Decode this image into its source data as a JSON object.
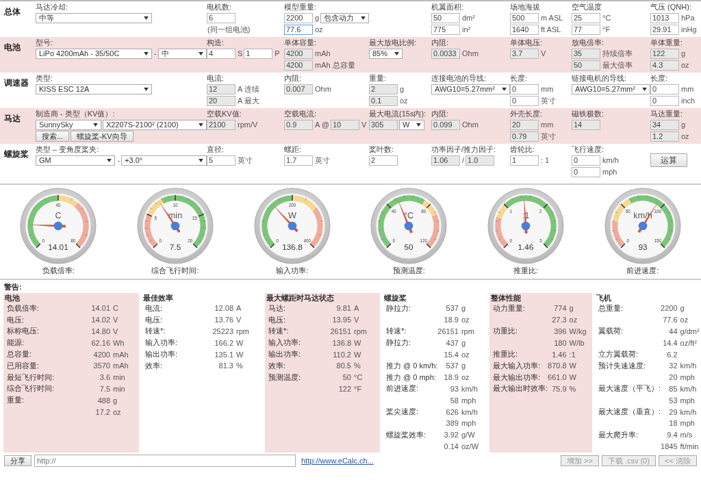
{
  "sections": [
    {
      "title": "总体",
      "cells": [
        {
          "label": "马达冷却:",
          "lines": [
            [
              {
                "kind": "select",
                "value": "中等"
              }
            ]
          ]
        },
        {
          "label": "电机数:",
          "lines": [
            [
              {
                "kind": "input",
                "value": "6",
                "readonly": false
              }
            ],
            [
              {
                "kind": "note",
                "text": "(同一组电池)"
              }
            ]
          ]
        },
        {
          "label": "模型重量:",
          "lines": [
            [
              {
                "kind": "input",
                "value": "2200",
                "readonly": false
              },
              {
                "kind": "unit",
                "text": "g"
              },
              {
                "kind": "select",
                "value": "包含动力"
              }
            ],
            [
              {
                "kind": "input",
                "value": "77.6",
                "readonly": false,
                "focused": true
              },
              {
                "kind": "unit",
                "text": "oz"
              }
            ]
          ]
        },
        {
          "label": "机翼面积:",
          "lines": [
            [
              {
                "kind": "input",
                "value": "50",
                "readonly": false
              },
              {
                "kind": "unit",
                "text": "dm²"
              }
            ],
            [
              {
                "kind": "input",
                "value": "775",
                "readonly": false
              },
              {
                "kind": "unit",
                "text": "in²"
              }
            ]
          ]
        },
        {
          "label": "场地海拔",
          "lines": [
            [
              {
                "kind": "input",
                "value": "500",
                "readonly": false
              },
              {
                "kind": "unit",
                "text": "m ASL"
              }
            ],
            [
              {
                "kind": "input",
                "value": "1640",
                "readonly": false
              },
              {
                "kind": "unit",
                "text": "ft ASL"
              }
            ]
          ]
        },
        {
          "label": "空气温度",
          "lines": [
            [
              {
                "kind": "input",
                "value": "25",
                "readonly": false
              },
              {
                "kind": "unit",
                "text": "°C"
              }
            ],
            [
              {
                "kind": "input",
                "value": "77",
                "readonly": false
              },
              {
                "kind": "unit",
                "text": "°F"
              }
            ]
          ]
        },
        {
          "label": "气压 (QNH):",
          "lines": [
            [
              {
                "kind": "input",
                "value": "1013",
                "readonly": false
              },
              {
                "kind": "unit",
                "text": "hPa"
              }
            ],
            [
              {
                "kind": "input",
                "value": "29.91",
                "readonly": false
              },
              {
                "kind": "unit",
                "text": "inHg"
              }
            ]
          ]
        }
      ]
    },
    {
      "title": "电池",
      "cells": [
        {
          "label": "型号:",
          "lines": [
            [
              {
                "kind": "select",
                "value": "LiPo 4200mAh - 35/50C"
              },
              {
                "kind": "unit",
                "text": "-"
              },
              {
                "kind": "select",
                "value": "中"
              }
            ]
          ]
        },
        {
          "label": "构造:",
          "lines": [
            [
              {
                "kind": "input",
                "value": "4",
                "readonly": false
              },
              {
                "kind": "unit",
                "text": "S"
              },
              {
                "kind": "input",
                "value": "1",
                "readonly": false
              },
              {
                "kind": "unit",
                "text": "P"
              }
            ]
          ]
        },
        {
          "label": "单体容量:",
          "lines": [
            [
              {
                "kind": "input",
                "value": "4200",
                "readonly": true
              },
              {
                "kind": "unit",
                "text": "mAh"
              }
            ],
            [
              {
                "kind": "input",
                "value": "4200",
                "readonly": true
              },
              {
                "kind": "unit",
                "text": "mAh 总容量"
              }
            ]
          ]
        },
        {
          "label": "最大放电比例:",
          "lines": [
            [
              {
                "kind": "select",
                "value": "85%"
              }
            ]
          ]
        },
        {
          "label": "内阻:",
          "lines": [
            [
              {
                "kind": "input",
                "value": "0.0033",
                "readonly": true
              },
              {
                "kind": "unit",
                "text": "Ohm"
              }
            ]
          ]
        },
        {
          "label": "单体电压:",
          "lines": [
            [
              {
                "kind": "input",
                "value": "3.7",
                "readonly": true
              },
              {
                "kind": "unit",
                "text": "V"
              }
            ]
          ]
        },
        {
          "label": "放电倍率:",
          "lines": [
            [
              {
                "kind": "input",
                "value": "35",
                "readonly": true
              },
              {
                "kind": "unit",
                "text": "持续倍率"
              }
            ],
            [
              {
                "kind": "input",
                "value": "50",
                "readonly": true
              },
              {
                "kind": "unit",
                "text": "最大倍率"
              }
            ]
          ]
        },
        {
          "label": "单体重量:",
          "lines": [
            [
              {
                "kind": "input",
                "value": "122",
                "readonly": true
              },
              {
                "kind": "unit",
                "text": "g"
              }
            ],
            [
              {
                "kind": "input",
                "value": "4.3",
                "readonly": true
              },
              {
                "kind": "unit",
                "text": "oz"
              }
            ]
          ]
        }
      ]
    },
    {
      "title": "调速器",
      "cells": [
        {
          "label": "类型:",
          "lines": [
            [
              {
                "kind": "select",
                "value": "KISS ESC 12A"
              }
            ]
          ]
        },
        {
          "label": "电流:",
          "lines": [
            [
              {
                "kind": "input",
                "value": "12",
                "readonly": true
              },
              {
                "kind": "unit",
                "text": "A 连续"
              }
            ],
            [
              {
                "kind": "input",
                "value": "20",
                "readonly": true
              },
              {
                "kind": "unit",
                "text": "A 最大"
              }
            ]
          ]
        },
        {
          "label": "内阻:",
          "lines": [
            [
              {
                "kind": "input",
                "value": "0.007",
                "readonly": true
              },
              {
                "kind": "unit",
                "text": "Ohm"
              }
            ]
          ]
        },
        {
          "label": "重量:",
          "lines": [
            [
              {
                "kind": "input",
                "value": "2",
                "readonly": true
              },
              {
                "kind": "unit",
                "text": "g"
              }
            ],
            [
              {
                "kind": "input",
                "value": "0.1",
                "readonly": true
              },
              {
                "kind": "unit",
                "text": "oz"
              }
            ]
          ]
        },
        {
          "label": "连接电池的导线:",
          "lines": [
            [
              {
                "kind": "select",
                "value": "AWG10=5.27mm²"
              }
            ]
          ]
        },
        {
          "label": "长度:",
          "lines": [
            [
              {
                "kind": "input",
                "value": "0",
                "readonly": false
              },
              {
                "kind": "unit",
                "text": "mm"
              }
            ],
            [
              {
                "kind": "input",
                "value": "0",
                "readonly": false
              },
              {
                "kind": "unit",
                "text": "英寸"
              }
            ]
          ]
        },
        {
          "label": "链接电机的导线:",
          "lines": [
            [
              {
                "kind": "select",
                "value": "AWG10=5.27mm²"
              }
            ]
          ]
        },
        {
          "label": "长度:",
          "lines": [
            [
              {
                "kind": "input",
                "value": "0",
                "readonly": false
              },
              {
                "kind": "unit",
                "text": "mm"
              }
            ],
            [
              {
                "kind": "input",
                "value": "0",
                "readonly": false
              },
              {
                "kind": "unit",
                "text": "inch"
              }
            ]
          ]
        }
      ]
    },
    {
      "title": "马达",
      "cells": [
        {
          "label": "制造商 - 类型（KV值）:",
          "lines": [
            [
              {
                "kind": "select",
                "value": "SunnySky"
              },
              {
                "kind": "select",
                "value": "X2207S-2100² (2100)"
              }
            ],
            [
              {
                "kind": "button",
                "text": "搜索..."
              },
              {
                "kind": "button",
                "text": "螺旋桨-KV向导"
              }
            ]
          ]
        },
        {
          "label": "空载KV值:",
          "lines": [
            [
              {
                "kind": "input",
                "value": "2100",
                "readonly": true
              },
              {
                "kind": "unit",
                "text": "rpm/V"
              }
            ]
          ]
        },
        {
          "label": "空载电流:",
          "lines": [
            [
              {
                "kind": "input",
                "value": "0.9",
                "readonly": true
              },
              {
                "kind": "unit",
                "text": "A @"
              },
              {
                "kind": "input",
                "value": "10",
                "readonly": true
              },
              {
                "kind": "unit",
                "text": "V"
              }
            ]
          ]
        },
        {
          "label": "最大电流(15s内):",
          "lines": [
            [
              {
                "kind": "input",
                "value": "305",
                "readonly": true
              },
              {
                "kind": "select",
                "value": "W"
              }
            ]
          ]
        },
        {
          "label": "内阻:",
          "lines": [
            [
              {
                "kind": "input",
                "value": "0.099",
                "readonly": true
              },
              {
                "kind": "unit",
                "text": "Ohm"
              }
            ]
          ]
        },
        {
          "label": "外壳长度:",
          "lines": [
            [
              {
                "kind": "input",
                "value": "20",
                "readonly": true
              },
              {
                "kind": "unit",
                "text": "mm"
              }
            ],
            [
              {
                "kind": "input",
                "value": "0.79",
                "readonly": true
              },
              {
                "kind": "unit",
                "text": "英寸"
              }
            ]
          ]
        },
        {
          "label": "磁铁极数:",
          "lines": [
            [
              {
                "kind": "input",
                "value": "14",
                "readonly": true
              }
            ]
          ]
        },
        {
          "label": "马达重量:",
          "lines": [
            [
              {
                "kind": "input",
                "value": "34",
                "readonly": true
              },
              {
                "kind": "unit",
                "text": "g"
              }
            ],
            [
              {
                "kind": "input",
                "value": "1.2",
                "readonly": true
              },
              {
                "kind": "unit",
                "text": "oz"
              }
            ]
          ]
        }
      ]
    },
    {
      "title": "螺旋桨",
      "cells": [
        {
          "label": "类型 – 变角度桨夹:",
          "lines": [
            [
              {
                "kind": "select",
                "value": "GM"
              },
              {
                "kind": "unit",
                "text": "-"
              },
              {
                "kind": "select",
                "value": "+3.0°"
              }
            ]
          ]
        },
        {
          "label": "直径:",
          "lines": [
            [
              {
                "kind": "input",
                "value": "5",
                "readonly": false
              },
              {
                "kind": "unit",
                "text": "英寸"
              }
            ]
          ]
        },
        {
          "label": "螺距:",
          "lines": [
            [
              {
                "kind": "input",
                "value": "1.7",
                "readonly": false
              },
              {
                "kind": "unit",
                "text": "英寸"
              }
            ]
          ]
        },
        {
          "label": "桨叶数:",
          "lines": [
            [
              {
                "kind": "input",
                "value": "2",
                "readonly": false
              }
            ]
          ]
        },
        {
          "label": "功率因子/推力因子:",
          "lines": [
            [
              {
                "kind": "input",
                "value": "1.06",
                "readonly": true
              },
              {
                "kind": "unit",
                "text": "/"
              },
              {
                "kind": "input",
                "value": "1.0",
                "readonly": true
              }
            ]
          ]
        },
        {
          "label": "齿轮比:",
          "lines": [
            [
              {
                "kind": "input",
                "value": "1",
                "readonly": false
              },
              {
                "kind": "unit",
                "text": ": 1"
              }
            ]
          ]
        },
        {
          "label": "飞行速度:",
          "lines": [
            [
              {
                "kind": "input",
                "value": "0",
                "readonly": false
              },
              {
                "kind": "unit",
                "text": "km/h"
              }
            ],
            [
              {
                "kind": "input",
                "value": "0",
                "readonly": false
              },
              {
                "kind": "unit",
                "text": "mph"
              }
            ]
          ]
        },
        {
          "lines": [
            [
              {
                "kind": "button",
                "text": "运算"
              }
            ]
          ]
        }
      ]
    }
  ],
  "gauges": [
    {
      "unit": "C",
      "value": "14.01",
      "label": "负载倍率:",
      "level": 0.175,
      "ticks": [
        "0",
        "40",
        "80"
      ]
    },
    {
      "unit": "min",
      "value": "7.5",
      "label": "综合飞行时间:",
      "level": 0.375,
      "ticks": [
        "0",
        "5",
        "10",
        "15",
        "20"
      ]
    },
    {
      "unit": "W",
      "value": "136.8",
      "label": "输入功率:",
      "level": 0.342,
      "ticks": [
        "0",
        "200",
        "400"
      ]
    },
    {
      "unit": "°C",
      "value": "50",
      "label": "预测温度:",
      "level": 0.417,
      "ticks": [
        "40",
        "80",
        "0",
        "120"
      ]
    },
    {
      "unit": ":1",
      "value": "1.46",
      "label": "推重比:",
      "level": 0.487,
      "ticks": [
        "1",
        "2",
        "0",
        "3"
      ]
    },
    {
      "unit": "km/h",
      "value": "93",
      "label": "前进速度:",
      "level": 0.62,
      "ticks": [
        "50",
        "100",
        "0",
        "150"
      ]
    }
  ],
  "warning_label": "警告:",
  "panels": [
    {
      "title": "电池",
      "rows": [
        {
          "label": "负载倍率:",
          "value": "14.01",
          "unit": "C"
        },
        {
          "label": "电压:",
          "value": "14.02",
          "unit": "V"
        },
        {
          "label": "标称电压:",
          "value": "14.80",
          "unit": "V"
        },
        {
          "label": "能源:",
          "value": "62.16",
          "unit": "Wh"
        },
        {
          "label": "总容量:",
          "value": "4200",
          "unit": "mAh"
        },
        {
          "label": "已用容量:",
          "value": "3570",
          "unit": "mAh"
        },
        {
          "label": "最短飞行时间:",
          "value": "3.6",
          "unit": "min"
        },
        {
          "label": "综合飞行时间:",
          "value": "7.5",
          "unit": "min"
        },
        {
          "label": "重量:",
          "value": "488",
          "unit": "g"
        },
        {
          "value": "17.2",
          "unit": "oz"
        }
      ]
    },
    {
      "title": "最佳效率",
      "rows": [
        {
          "label": "电流:",
          "value": "12.08",
          "unit": "A"
        },
        {
          "label": "电压:",
          "value": "13.76",
          "unit": "V"
        },
        {
          "label": "转速*:",
          "value": "25223",
          "unit": "rpm"
        },
        {
          "label": "输入功率:",
          "value": "166.2",
          "unit": "W"
        },
        {
          "label": "输出功率:",
          "value": "135.1",
          "unit": "W"
        },
        {
          "label": "效率:",
          "value": "81.3",
          "unit": "%"
        }
      ]
    },
    {
      "title": "最大螺距时马达状态",
      "rows": [
        {
          "label": "马达:",
          "value": "9.81",
          "unit": "A"
        },
        {
          "label": "电压:",
          "value": "13.95",
          "unit": "V"
        },
        {
          "label": "转速*:",
          "value": "26151",
          "unit": "rpm"
        },
        {
          "label": "输入功率:",
          "value": "136.8",
          "unit": "W"
        },
        {
          "label": "输出功率:",
          "value": "110.2",
          "unit": "W"
        },
        {
          "label": "效率:",
          "value": "80.5",
          "unit": "%"
        },
        {
          "label": "预测温度:",
          "value": "50",
          "unit": "°C"
        },
        {
          "value": "122",
          "unit": "°F"
        }
      ]
    },
    {
      "title": "螺旋桨",
      "rows": [
        {
          "label": "静拉力:",
          "value": "537",
          "unit": "g"
        },
        {
          "value": "18.9",
          "unit": "oz"
        },
        {
          "label": "转速*:",
          "value": "26151",
          "unit": "rpm"
        },
        {
          "label": "静拉力:",
          "value": "437",
          "unit": "g"
        },
        {
          "value": "15.4",
          "unit": "oz"
        },
        {
          "label": "推力 @ 0 km/h:",
          "value": "537",
          "unit": "g"
        },
        {
          "label": "推力 @ 0 mph:",
          "value": "18.9",
          "unit": "oz"
        },
        {
          "label": "前进速度:",
          "value": "93",
          "unit": "km/h"
        },
        {
          "value": "58",
          "unit": "mph"
        },
        {
          "label": "桨尖速度:",
          "value": "626",
          "unit": "km/h"
        },
        {
          "value": "389",
          "unit": "mph"
        },
        {
          "label": "螺旋桨效率:",
          "value": "3.92",
          "unit": "g/W"
        },
        {
          "value": "0.14",
          "unit": "oz/W"
        }
      ]
    },
    {
      "title": "整体性能",
      "rows": [
        {
          "label": "动力重量:",
          "value": "774",
          "unit": "g"
        },
        {
          "value": "27.3",
          "unit": "oz"
        },
        {
          "label": "功重比:",
          "value": "396",
          "unit": "W/kg"
        },
        {
          "value": "180",
          "unit": "W/lb"
        },
        {
          "label": "推重比:",
          "value": "1.46",
          "unit": ":1"
        },
        {
          "label": "最大输入功率:",
          "value": "870.8",
          "unit": "W"
        },
        {
          "label": "最大输出功率:",
          "value": "661.0",
          "unit": "W"
        },
        {
          "label": "最大输出时效率:",
          "value": "75.9",
          "unit": "%"
        }
      ]
    },
    {
      "title": "飞机",
      "rows": [
        {
          "label": "总重量:",
          "value": "2200",
          "unit": "g"
        },
        {
          "value": "77.6",
          "unit": "oz"
        },
        {
          "label": "翼载荷:",
          "value": "44",
          "unit": "g/dm²"
        },
        {
          "value": "14.4",
          "unit": "oz/ft²"
        },
        {
          "label": "立方翼载荷:",
          "value": "6.2"
        },
        {
          "label": "预计失速速度:",
          "value": "32",
          "unit": "km/h"
        },
        {
          "value": "20",
          "unit": "mph"
        },
        {
          "label": "最大速度（平飞）:",
          "value": "85",
          "unit": "km/h"
        },
        {
          "value": "53",
          "unit": "mph"
        },
        {
          "label": "最大速度（垂直）:",
          "value": "29",
          "unit": "km/h"
        },
        {
          "value": "18",
          "unit": "mph"
        },
        {
          "label": "最大爬升率:",
          "value": "9.4",
          "unit": "m/s"
        },
        {
          "value": "1845",
          "unit": "ft/min"
        }
      ]
    }
  ],
  "footer": {
    "share_button": "分享",
    "url_field": {
      "placeholder": "http://"
    },
    "link": "http://www.eCalc.ch...",
    "buttons": [
      {
        "text": "增加 >>",
        "disabled": true
      },
      {
        "text": "下载 .csv (0)",
        "disabled": true
      },
      {
        "text": "<< 清除",
        "disabled": true
      }
    ]
  }
}
